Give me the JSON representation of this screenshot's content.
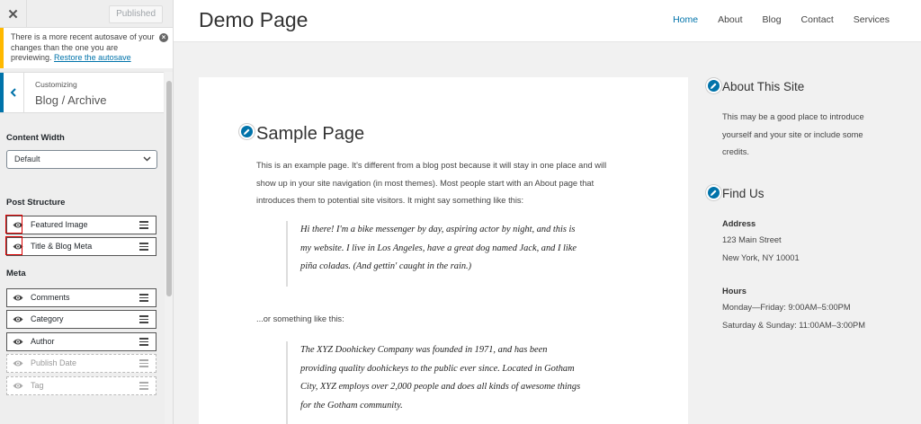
{
  "customizer": {
    "close_label": "✕",
    "publish_label": "Published",
    "notice": {
      "text": "There is a more recent autosave of your changes than the one you are previewing.",
      "link": "Restore the autosave",
      "dismiss_label": "×"
    },
    "panel": {
      "breadcrumb": "Customizing",
      "title": "Blog / Archive"
    },
    "content_width": {
      "label": "Content Width",
      "selected": "Default"
    },
    "post_structure": {
      "label": "Post Structure",
      "items": [
        {
          "label": "Featured Image",
          "visible": true
        },
        {
          "label": "Title & Blog Meta",
          "visible": true
        }
      ]
    },
    "meta": {
      "label": "Meta",
      "items": [
        {
          "label": "Comments",
          "visible": true
        },
        {
          "label": "Category",
          "visible": true
        },
        {
          "label": "Author",
          "visible": true
        },
        {
          "label": "Publish Date",
          "visible": false
        },
        {
          "label": "Tag",
          "visible": false
        }
      ]
    },
    "colors": {
      "accent": "#0073aa",
      "notice": "#ffb900",
      "highlight": "#dd0000"
    }
  },
  "site": {
    "title": "Demo Page",
    "nav": [
      "Home",
      "About",
      "Blog",
      "Contact",
      "Services"
    ],
    "page": {
      "title": "Sample Page",
      "intro_lines": [
        "This is an example page. It's different from a blog post because it will stay in one place and will",
        "show up in your site navigation (in most themes). Most people start with an About page that",
        "introduces them to potential site visitors. It might say something like this:"
      ],
      "quote1_lines": [
        "Hi there! I'm a bike messenger by day, aspiring actor by night, and this is",
        "my website. I live in Los Angeles, have a great dog named Jack, and I like",
        "piña coladas. (And gettin' caught in the rain.)"
      ],
      "between": "...or something like this:",
      "quote2_lines": [
        "The XYZ Doohickey Company was founded in 1971, and has been",
        "providing quality doohickeys to the public ever since. Located in Gotham",
        "City, XYZ employs over 2,000 people and does all kinds of awesome things",
        "for the Gotham community."
      ]
    },
    "widgets": {
      "about": {
        "title": "About This Site",
        "lines": [
          "This may be a good place to introduce",
          "yourself and your site or include some",
          "credits."
        ]
      },
      "find": {
        "title": "Find Us",
        "address_label": "Address",
        "address_lines": [
          "123 Main Street",
          "New York, NY 10001"
        ],
        "hours_label": "Hours",
        "hours_lines": [
          "Monday—Friday: 9:00AM–5:00PM",
          "Saturday & Sunday: 11:00AM–3:00PM"
        ]
      }
    }
  }
}
